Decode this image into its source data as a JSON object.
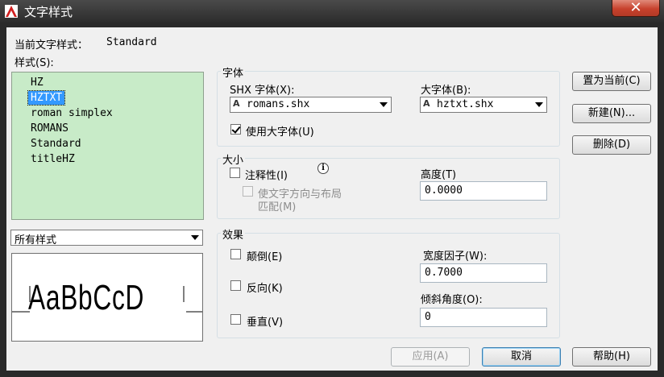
{
  "window": {
    "title": "文字样式",
    "close_glyph": "✕"
  },
  "current_style": {
    "label": "当前文字样式：",
    "value": "Standard"
  },
  "styles": {
    "label": "样式(S):",
    "items": [
      "HZ",
      "HZTXT",
      "roman simplex",
      "ROMANS",
      "Standard",
      "titleHZ"
    ],
    "selected": "HZTXT"
  },
  "filter": {
    "value": "所有样式"
  },
  "preview": {
    "text": "AaBbCcD"
  },
  "font": {
    "group_label": "字体",
    "shx_label": "SHX 字体(X):",
    "shx_value": "romans.shx",
    "big_label": "大字体(B):",
    "big_value": "hztxt.shx",
    "use_big_label": "使用大字体(U)",
    "use_big_checked": true
  },
  "size": {
    "group_label": "大小",
    "annotative_label": "注释性(I)",
    "annotative_checked": false,
    "orient_label_line1": "使文字方向与布局",
    "orient_label_line2": "匹配(M)",
    "height_label": "高度(T)",
    "height_value": "0.0000"
  },
  "effects": {
    "group_label": "效果",
    "upside_down_label": "颠倒(E)",
    "backwards_label": "反向(K)",
    "vertical_label": "垂直(V)",
    "width_label": "宽度因子(W):",
    "width_value": "0.7000",
    "oblique_label": "倾斜角度(O):",
    "oblique_value": "0"
  },
  "buttons": {
    "set_current": "置为当前(C)",
    "new": "新建(N)...",
    "delete": "删除(D)",
    "apply": "应用(A)",
    "cancel": "取消",
    "help": "帮助(H)"
  },
  "colors": {
    "list_bg": "#c8ebc8",
    "selection": "#3399ff",
    "close_red": "#c7412c"
  }
}
